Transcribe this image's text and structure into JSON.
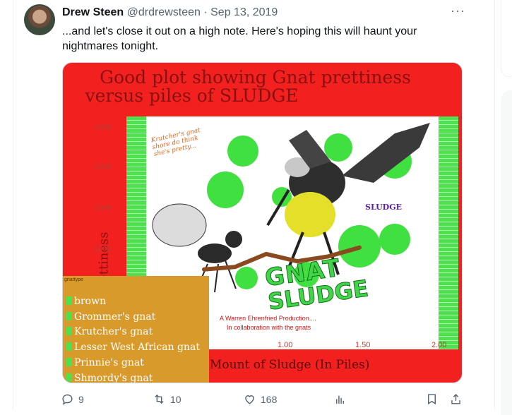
{
  "post": {
    "author_name": "Drew Steen",
    "author_handle": "@drdrewsteen",
    "separator": "·",
    "date": "Sep 13, 2019",
    "more": "···",
    "text": "...and let's close it out on a high note. Here's hoping this will haunt your nightmares tonight."
  },
  "chart_data": {
    "type": "line",
    "title_line1": "Good plot showing Gnat prettiness",
    "title_line2": "versus piles of SLUDGE",
    "ylabel": "Gnat Prettiness",
    "xlabel": "Mount of Sludge (In Piles)",
    "y_ticks": [
      "1000",
      "2000",
      "3000",
      "4000"
    ],
    "x_ticks": [
      "1.00",
      "1.50",
      "2.00"
    ],
    "legend_title": "gnattype",
    "legend": [
      "brown",
      "Grommer's gnat",
      "Krutcher's gnat",
      "Lesser West African gnat",
      "Prinnie's gnat",
      "Shmordy's gnat"
    ],
    "annotation": "Krutcher's gnat shore do think she's pretty...",
    "sludge_label": "SLUDGE",
    "overlay_word1": "GNAT",
    "overlay_word2": "SLUDGE",
    "credit_line1": "A Warren Ehrenfried Production....",
    "credit_line2": "In collaboration with the gnats",
    "series": [
      {
        "name": "brown",
        "x": [
          0.5,
          0.7,
          0.9,
          1.1,
          1.3,
          1.5
        ],
        "y": [
          500,
          560,
          880,
          700,
          820,
          1040
        ]
      }
    ],
    "colors": {
      "panel": "#f2211f",
      "title": "#8a1010",
      "legend_bg": "#d89a2a",
      "band": "#4fe04f",
      "line": "#8a4a20"
    }
  },
  "actions": {
    "replies": "9",
    "reposts": "10",
    "likes": "168"
  }
}
